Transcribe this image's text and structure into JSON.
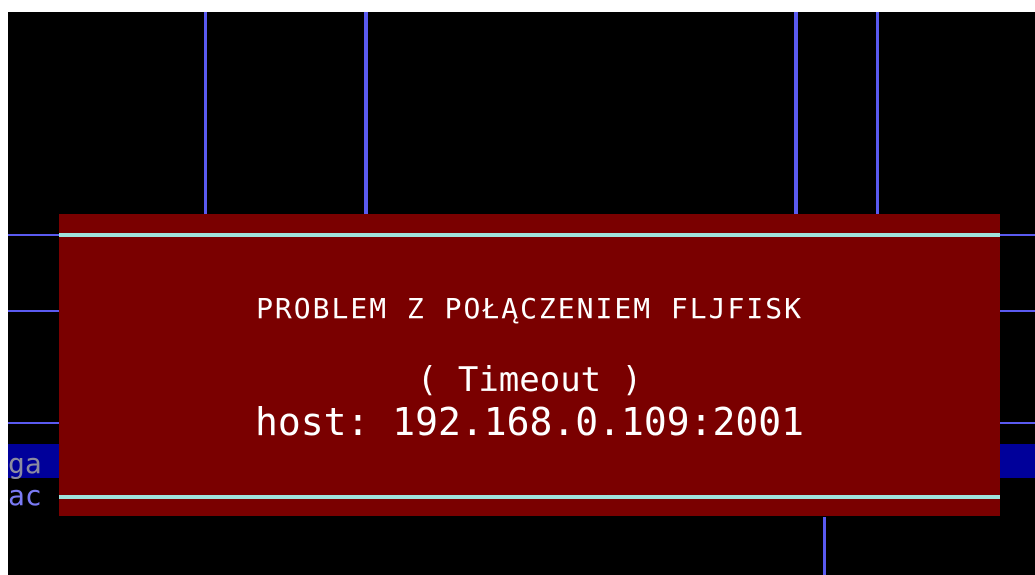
{
  "dialog": {
    "title": "PROBLEM Z POŁĄCZENIEM FLJFISK",
    "detail": "( Timeout )",
    "host": "host: 192.168.0.109:2001"
  },
  "background": {
    "row_text_1": "ga",
    "row_text_2": "ac"
  },
  "colors": {
    "screen_background": "#000000",
    "grid_lines": "#5a5af0",
    "dialog_background": "#7a0000",
    "dialog_rules": "#9fe3dd",
    "dialog_text": "#ffffff",
    "selected_row": "#00009a"
  }
}
